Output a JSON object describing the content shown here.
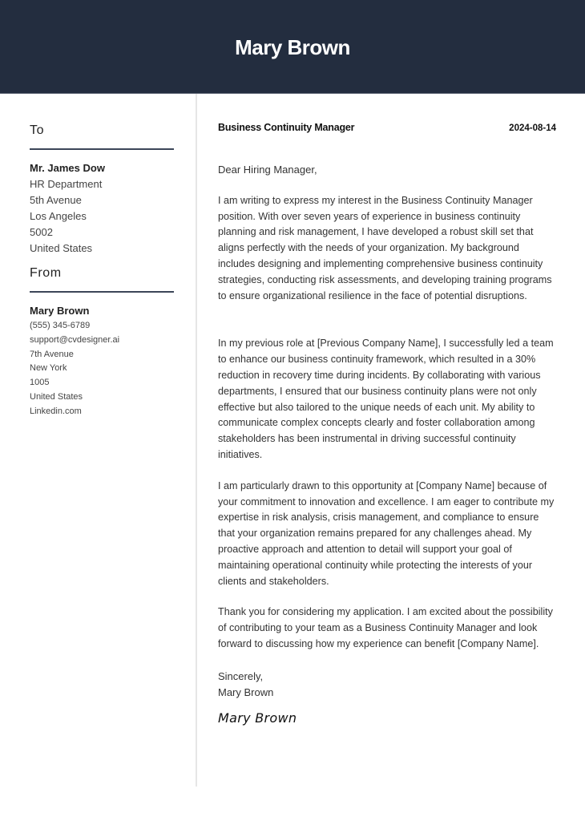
{
  "header": {
    "name": "Mary Brown"
  },
  "sidebar": {
    "to": {
      "title": "To",
      "name": "Mr. James Dow",
      "lines": [
        "HR Department",
        "5th Avenue",
        "Los Angeles",
        "5002",
        "United States"
      ]
    },
    "from": {
      "title": "From",
      "name": "Mary Brown",
      "lines": [
        "(555) 345-6789",
        "support@cvdesigner.ai",
        "7th Avenue",
        "New York",
        "1005",
        "United States",
        "Linkedin.com"
      ]
    }
  },
  "letter": {
    "job_title": "Business Continuity Manager",
    "date": "2024-08-14",
    "salutation": "Dear Hiring Manager,",
    "paragraphs": [
      "I am writing to express my interest in the Business Continuity Manager position. With over seven years of experience in business continuity planning and risk management, I have developed a robust skill set that aligns perfectly with the needs of your organization. My background includes designing and implementing comprehensive business continuity strategies, conducting risk assessments, and developing training programs to ensure organizational resilience in the face of potential disruptions.",
      "In my previous role at [Previous Company Name], I successfully led a team to enhance our business continuity framework, which resulted in a 30% reduction in recovery time during incidents. By collaborating with various departments, I ensured that our business continuity plans were not only effective but also tailored to the unique needs of each unit. My ability to communicate complex concepts clearly and foster collaboration among stakeholders has been instrumental in driving successful continuity initiatives.",
      "I am particularly drawn to this opportunity at [Company Name] because of your commitment to innovation and excellence. I am eager to contribute my expertise in risk analysis, crisis management, and compliance to ensure that your organization remains prepared for any challenges ahead. My proactive approach and attention to detail will support your goal of maintaining operational continuity while protecting the interests of your clients and stakeholders.",
      "Thank you for considering my application. I am excited about the possibility of contributing to your team as a Business Continuity Manager and look forward to discussing how my experience can benefit [Company Name]."
    ],
    "closing": "Sincerely,",
    "closing_name": "Mary Brown",
    "signature": "Mary Brown"
  },
  "colors": {
    "header_bg": "#232d3f",
    "rule": "#3c4658",
    "divider": "#e6e6e6"
  }
}
